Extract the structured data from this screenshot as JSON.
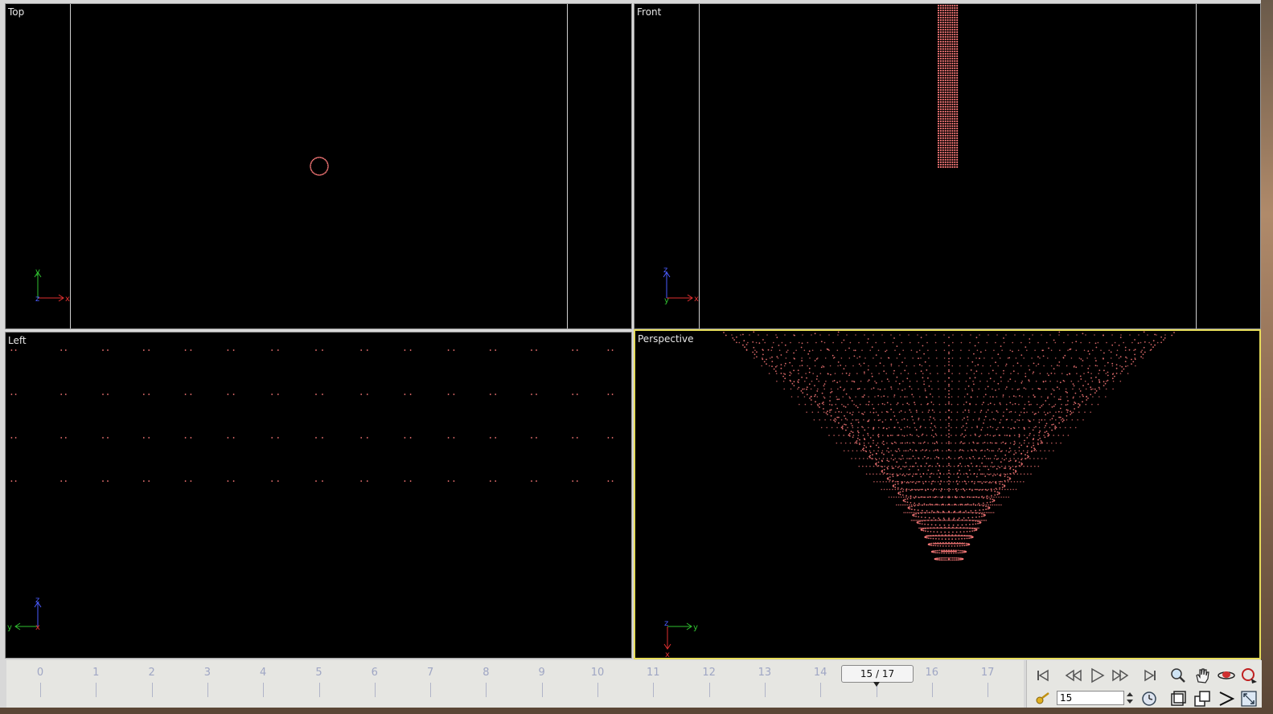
{
  "viewports": {
    "top": {
      "label": "Top",
      "axes": {
        "u": "x",
        "v": "y",
        "w": "z"
      }
    },
    "front": {
      "label": "Front",
      "axes": {
        "u": "x",
        "v": "z",
        "w": "y"
      }
    },
    "left": {
      "label": "Left",
      "axes": {
        "u": "y",
        "v": "z",
        "w": "x"
      }
    },
    "perspective": {
      "label": "Perspective",
      "active": true,
      "axes": {
        "u": "y",
        "v": "x",
        "w": "z"
      }
    }
  },
  "colors": {
    "point_cloud": "#ff7b7b",
    "active_border": "#e6dc5a",
    "axis_x": "#e03030",
    "axis_y": "#30c030",
    "axis_z": "#4a5cff"
  },
  "timeline": {
    "ticks": [
      "0",
      "1",
      "2",
      "3",
      "4",
      "5",
      "6",
      "7",
      "8",
      "9",
      "10",
      "11",
      "12",
      "13",
      "14",
      "15",
      "16",
      "17"
    ],
    "current_frame_display": "15 / 17",
    "current_frame": 15,
    "last_frame": 17
  },
  "controls": {
    "frame_input_value": "15",
    "buttons": [
      "first-frame-icon",
      "rewind-icon",
      "play-icon",
      "fast-forward-icon",
      "last-frame-icon",
      "zoom-icon",
      "pan-hand-icon",
      "orbit-icon",
      "rotate-camera-icon",
      "key-icon",
      "clock-icon",
      "view-box-icon",
      "multi-view-icon",
      "cursor-arrow-icon",
      "fit-view-icon"
    ]
  }
}
